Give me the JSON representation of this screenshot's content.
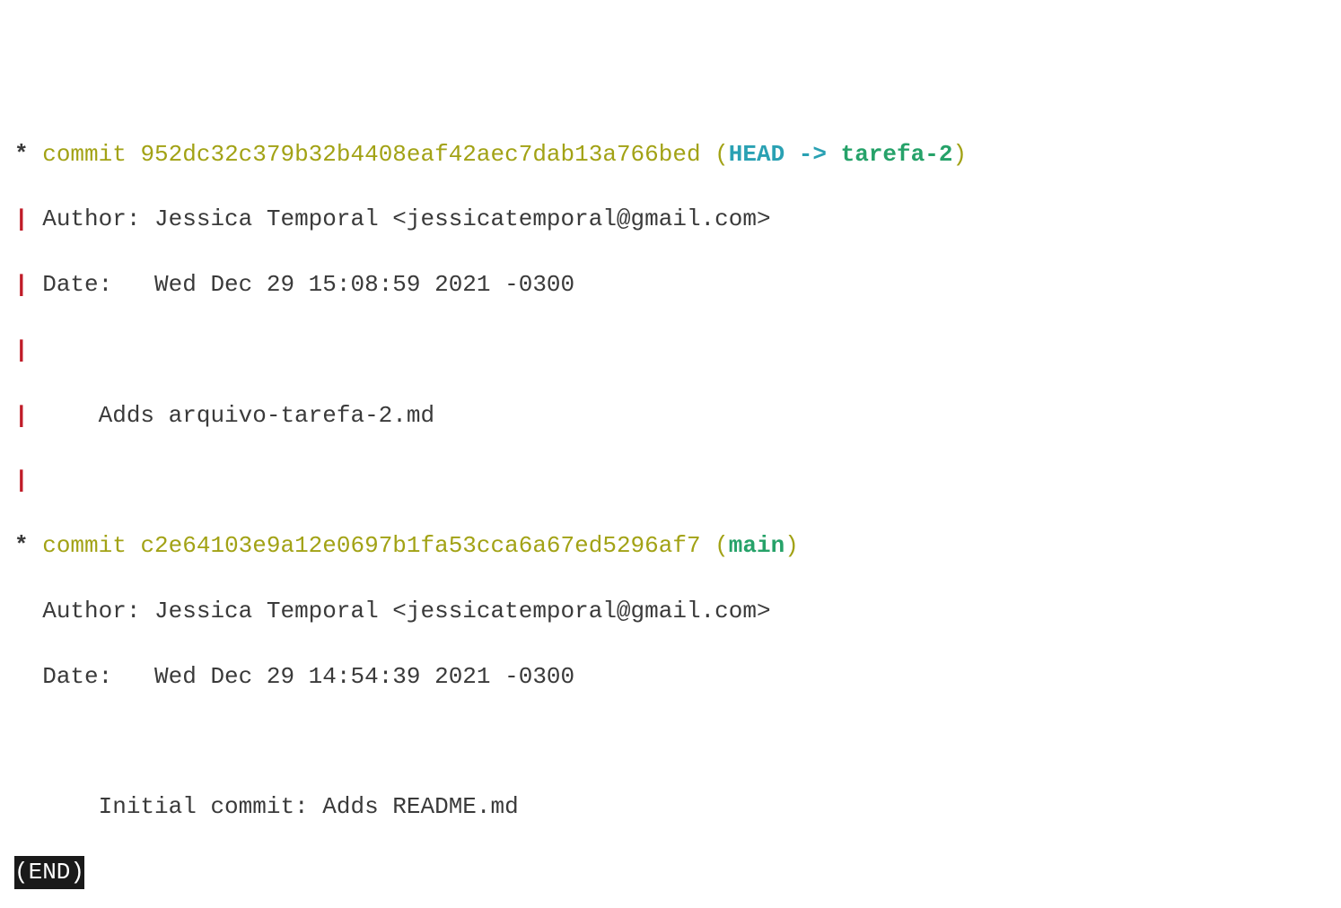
{
  "commits": [
    {
      "graph_node": "*",
      "graph_pipe": "|",
      "commit_word": "commit",
      "hash": "952dc32c379b32b4408eaf42aec7dab13a766bed",
      "refs": {
        "open_paren": "(",
        "head": "HEAD",
        "arrow": " -> ",
        "branch": "tarefa-2",
        "close_paren": ")"
      },
      "author_label": "Author:",
      "author_value": "Jessica Temporal <jessicatemporal@gmail.com>",
      "date_label": "Date:",
      "date_value": "Wed Dec 29 15:08:59 2021 -0300",
      "message": "Adds arquivo-tarefa-2.md"
    },
    {
      "graph_node": "*",
      "commit_word": "commit",
      "hash": "c2e64103e9a12e0697b1fa53cca6a67ed5296af7",
      "refs": {
        "open_paren": "(",
        "branch": "main",
        "close_paren": ")"
      },
      "author_label": "Author:",
      "author_value": "Jessica Temporal <jessicatemporal@gmail.com>",
      "date_label": "Date:",
      "date_value": "Wed Dec 29 14:54:39 2021 -0300",
      "message": "Initial commit: Adds README.md"
    }
  ],
  "pager_end": "(END)"
}
